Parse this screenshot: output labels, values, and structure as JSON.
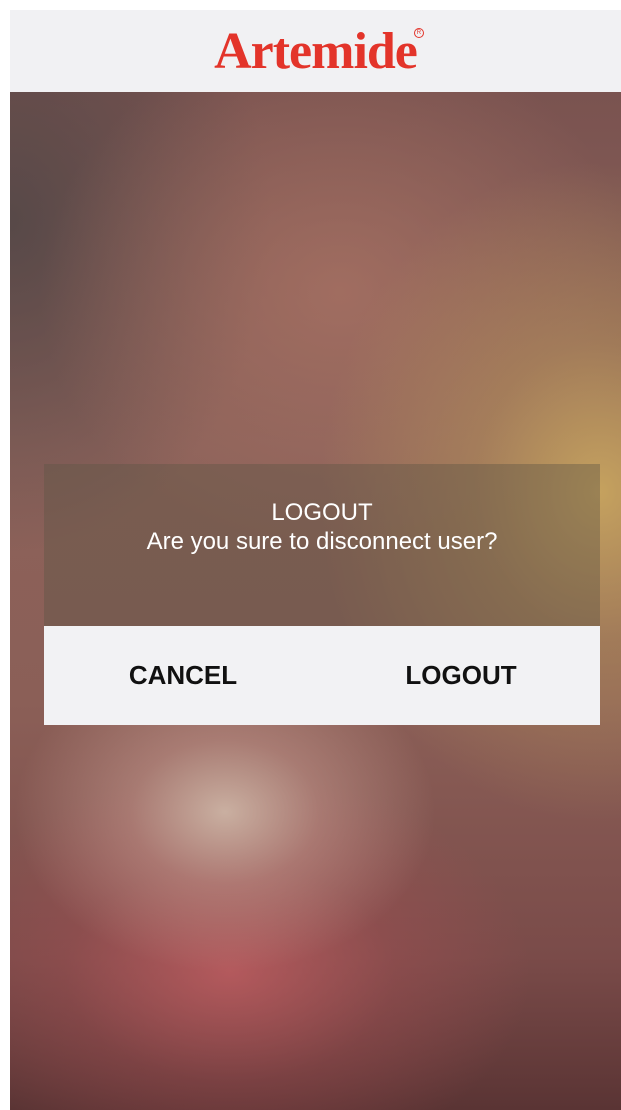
{
  "header": {
    "brand": "Artemide",
    "registered_mark": "R"
  },
  "dialog": {
    "title": "LOGOUT",
    "message": "Are you sure to disconnect user?",
    "cancel_label": "CANCEL",
    "confirm_label": "LOGOUT"
  },
  "colors": {
    "brand_red": "#e3342a",
    "header_bg": "#f1f1f3",
    "button_bar_bg": "#f2f2f4",
    "button_text": "#111111",
    "dialog_text": "#ffffff"
  }
}
